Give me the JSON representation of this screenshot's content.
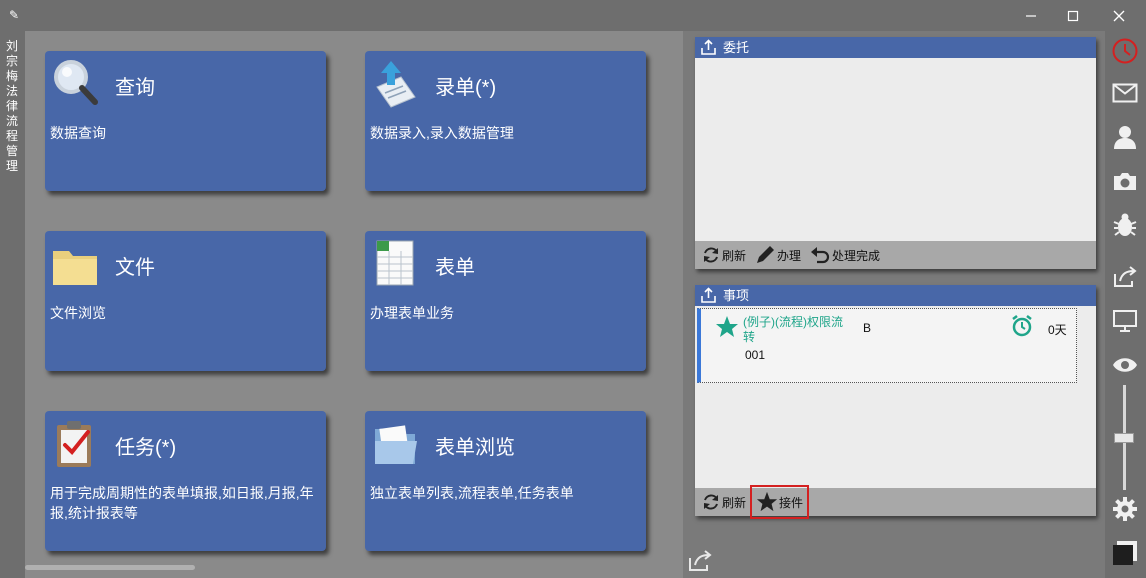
{
  "window": {
    "vertical_title": "刘宗梅法律流程管理",
    "buttons": {
      "minimize": "minimize-icon",
      "maximize": "maximize-icon",
      "close": "close-icon"
    }
  },
  "tiles": [
    {
      "title": "查询",
      "desc": "数据查询",
      "icon": "magnifier-icon"
    },
    {
      "title": "录单(*)",
      "desc": "数据录入,录入数据管理",
      "icon": "document-entry-icon"
    },
    {
      "title": "文件",
      "desc": "文件浏览",
      "icon": "folder-icon"
    },
    {
      "title": "表单",
      "desc": "办理表单业务",
      "icon": "spreadsheet-icon"
    },
    {
      "title": "任务(*)",
      "desc": "用于完成周期性的表单填报,如日报,月报,年报,统计报表等",
      "icon": "clipboard-check-icon"
    },
    {
      "title": "表单浏览",
      "desc": "独立表单列表,流程表单,任务表单",
      "icon": "blue-folder-icon"
    }
  ],
  "panel_delegate": {
    "title": "委托",
    "actions": {
      "refresh": "刷新",
      "handle": "办理",
      "done": "处理完成"
    }
  },
  "panel_items": {
    "title": "事项",
    "item": {
      "name": "(例子)(流程)权限流转",
      "code": "001",
      "status": "B",
      "days": "0天"
    },
    "actions": {
      "refresh": "刷新",
      "accept": "接件"
    }
  },
  "colors": {
    "tile_bg": "#4867a8",
    "accent_red": "#d42020",
    "teal": "#1fa58a"
  }
}
